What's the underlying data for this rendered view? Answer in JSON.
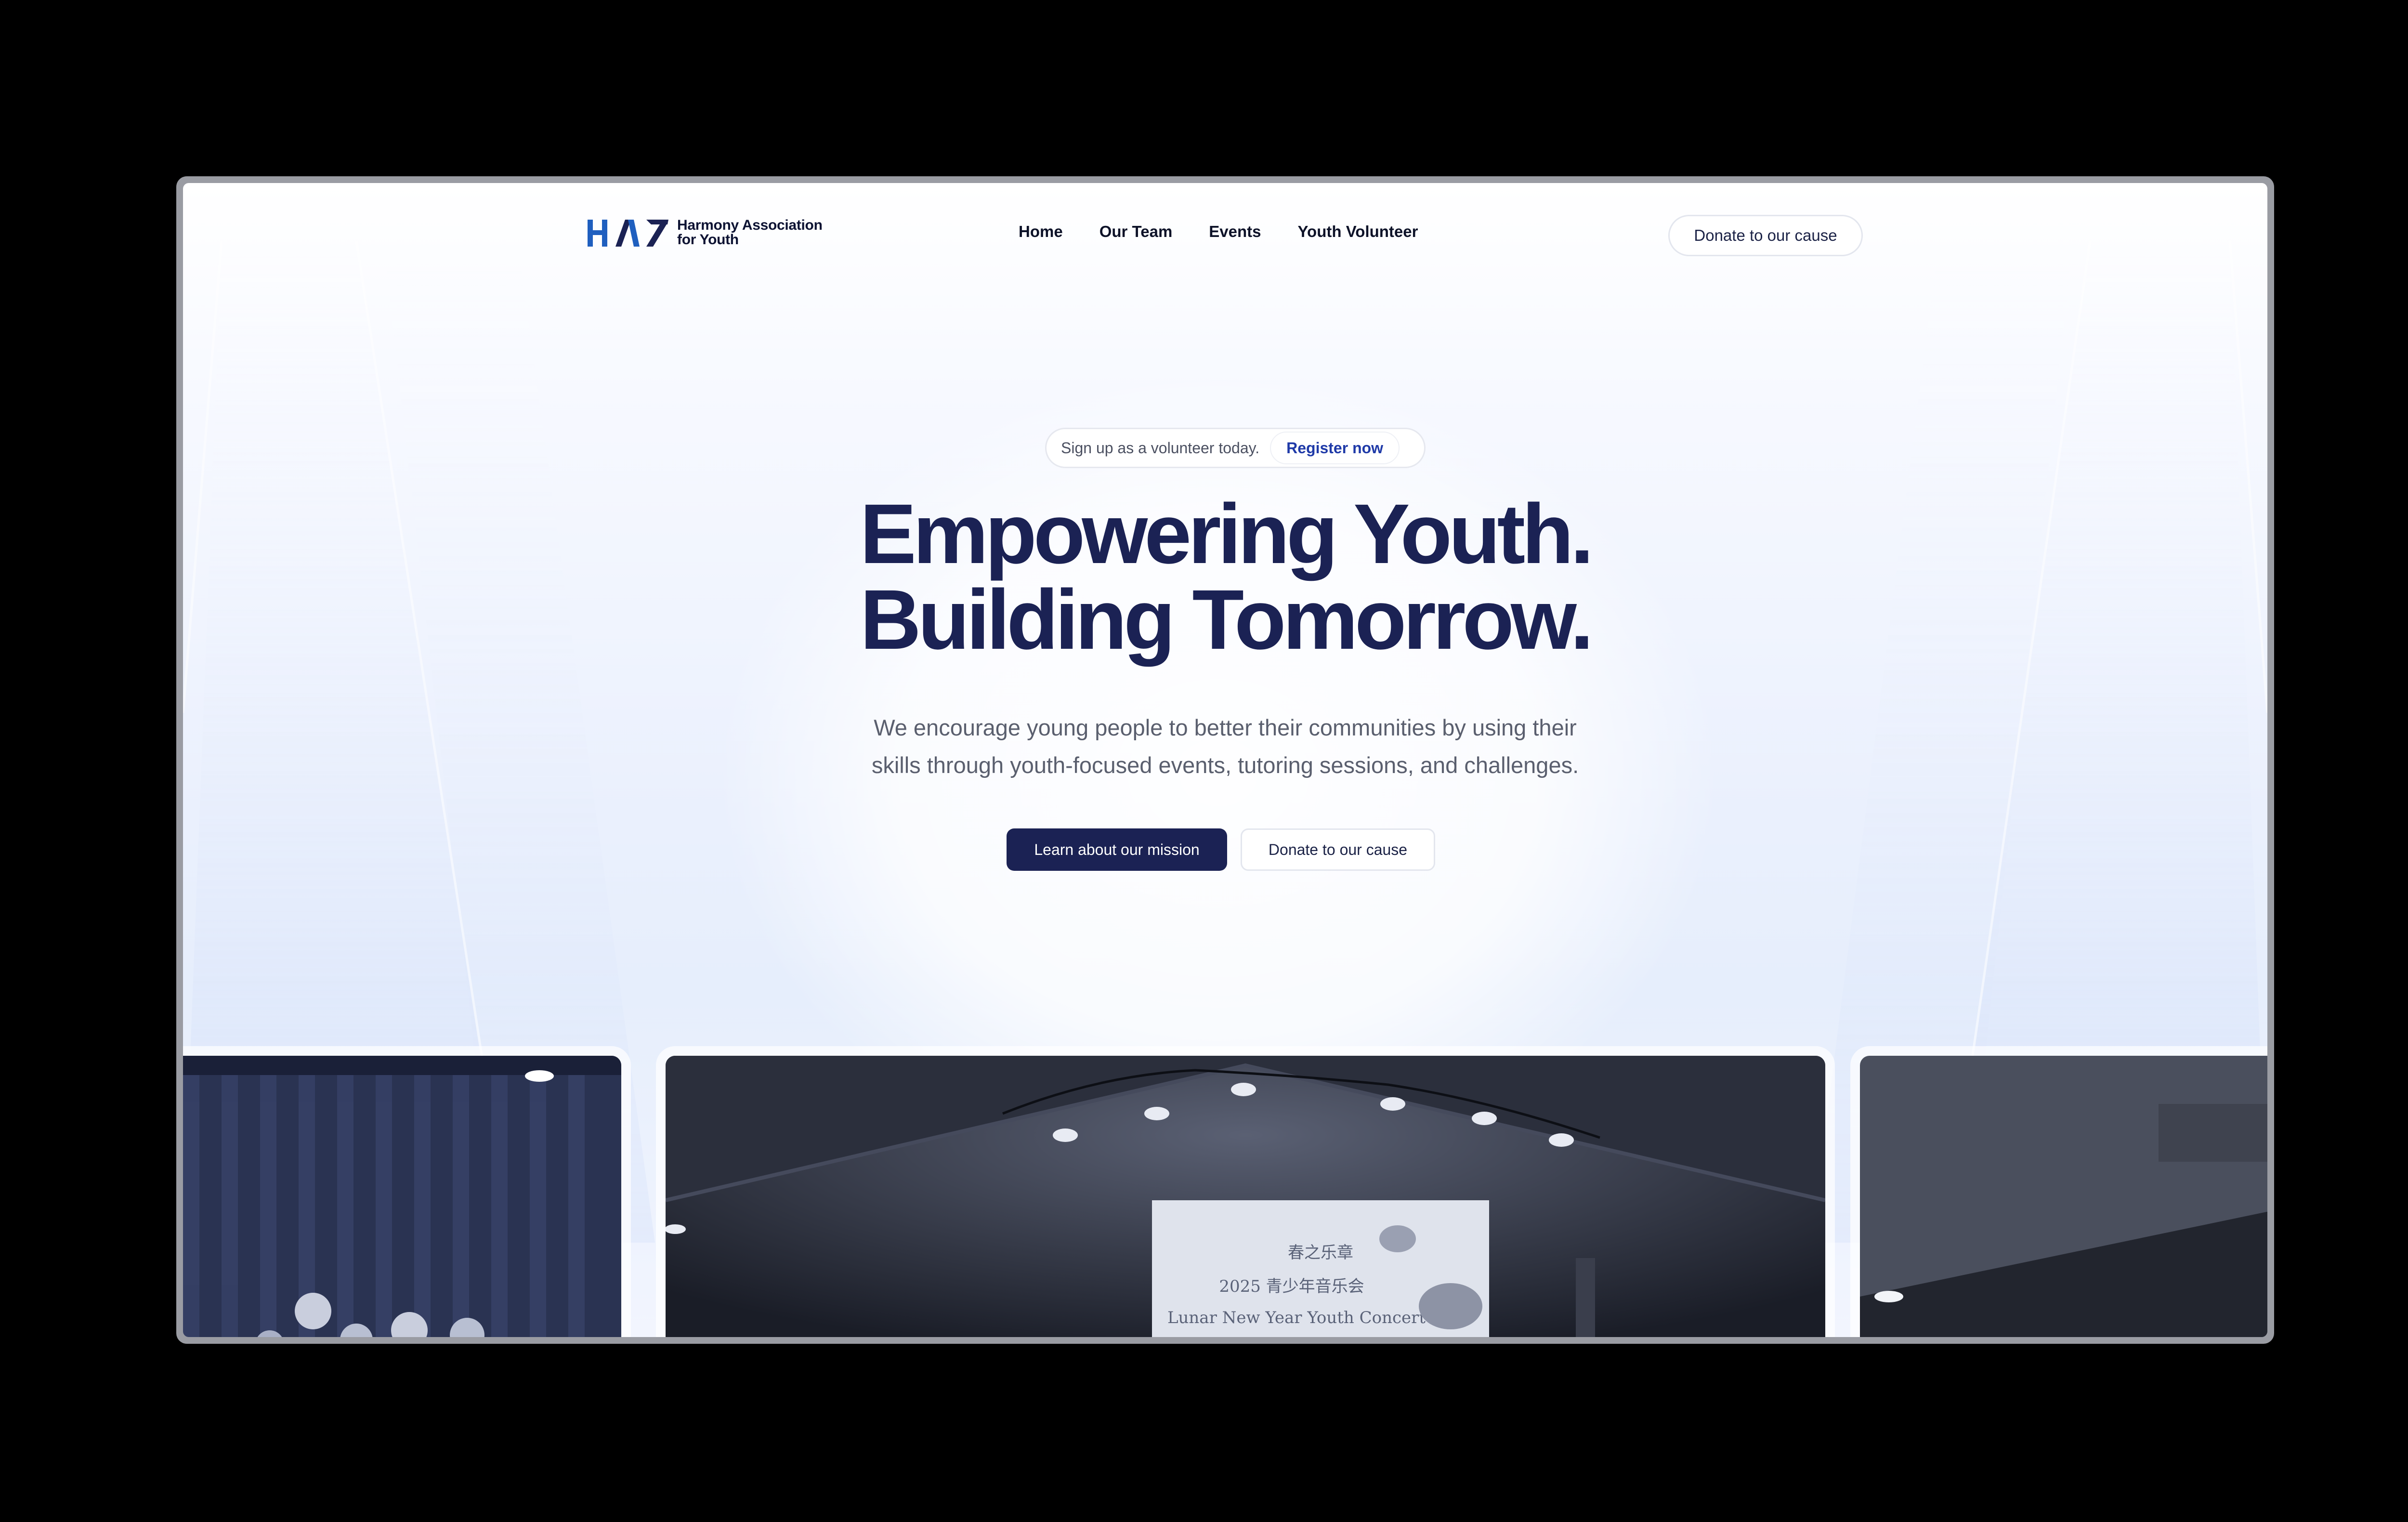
{
  "brand": {
    "logo_mark_text": "HAY",
    "name_line1": "Harmony Association",
    "name_line2": "for Youth"
  },
  "nav": {
    "links": [
      "Home",
      "Our Team",
      "Events",
      "Youth Volunteer"
    ],
    "cta_label": "Donate to our cause"
  },
  "announcement": {
    "text": "Sign up as a volunteer today.",
    "button_label": "Register now"
  },
  "hero": {
    "headline_line1": "Empowering Youth.",
    "headline_line2": "Building Tomorrow.",
    "subtitle_line1": "We encourage young people to better their communities by using their",
    "subtitle_line2": "skills through youth-focused events, tutoring sessions, and challenges.",
    "primary_button": "Learn about our mission",
    "secondary_button": "Donate to our cause"
  },
  "gallery": {
    "photo2_caption_line1": "春之乐章",
    "photo2_caption_line2": "2025 青少年音乐会",
    "photo2_caption_line3": "Lunar New Year Youth Concert"
  },
  "colors": {
    "brand_navy": "#1b2254",
    "accent_link": "#1f3aa8",
    "page_background": "#eaf0fd"
  }
}
